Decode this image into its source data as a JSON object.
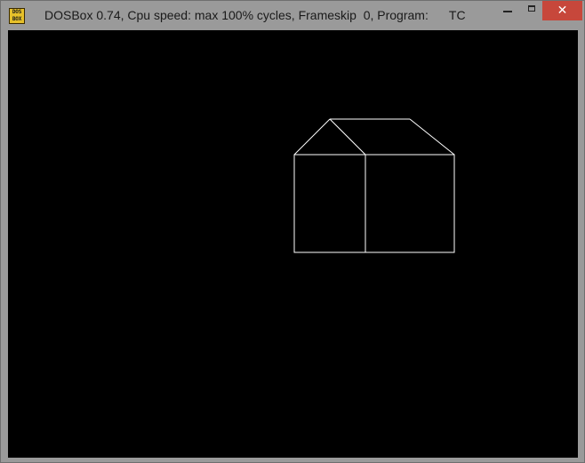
{
  "window": {
    "title": "DOSBox 0.74, Cpu speed: max 100% cycles, Frameskip  0, Program:      TC",
    "icon_label_top": "DOS",
    "icon_label_bottom": "BOX",
    "icon": "dosbox-icon",
    "close_glyph": "✕",
    "colors": {
      "titlebar": "#9a9a9a",
      "close_button": "#c7473b",
      "screen_background": "#000000",
      "drawing_stroke": "#ffffff"
    }
  },
  "screen": {
    "drawing": "house-outline"
  }
}
